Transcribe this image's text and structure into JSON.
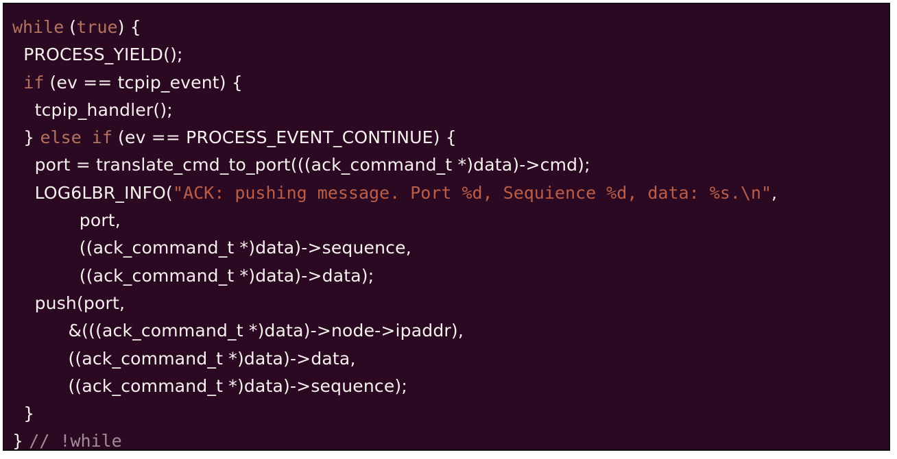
{
  "editor": {
    "background": "#2c0922",
    "colors": {
      "text": "#f6f1ec",
      "keyword": "#b4735f",
      "string": "#bc5e47",
      "comment": "#9e8e94"
    },
    "lines": [
      [
        {
          "t": "kw",
          "v": "while"
        },
        {
          "t": "txt",
          "v": " ("
        },
        {
          "t": "kw",
          "v": "true"
        },
        {
          "t": "txt",
          "v": ") {"
        }
      ],
      [
        {
          "t": "txt",
          "v": "  PROCESS_YIELD();"
        }
      ],
      [
        {
          "t": "txt",
          "v": "  "
        },
        {
          "t": "kw",
          "v": "if"
        },
        {
          "t": "txt",
          "v": " (ev == tcpip_event) {"
        }
      ],
      [
        {
          "t": "txt",
          "v": "    tcpip_handler();"
        }
      ],
      [
        {
          "t": "txt",
          "v": "  } "
        },
        {
          "t": "kw",
          "v": "else if"
        },
        {
          "t": "txt",
          "v": " (ev == PROCESS_EVENT_CONTINUE) {"
        }
      ],
      [
        {
          "t": "txt",
          "v": "    port = translate_cmd_to_port(((ack_command_t *)data)->cmd);"
        }
      ],
      [
        {
          "t": "txt",
          "v": "    LOG6LBR_INFO("
        },
        {
          "t": "str",
          "v": "\"ACK: pushing message. Port %d, Sequience %d, data: %s.\\n\""
        },
        {
          "t": "txt",
          "v": ","
        }
      ],
      [
        {
          "t": "txt",
          "v": "            port,"
        }
      ],
      [
        {
          "t": "txt",
          "v": "            ((ack_command_t *)data)->sequence,"
        }
      ],
      [
        {
          "t": "txt",
          "v": "            ((ack_command_t *)data)->data);"
        }
      ],
      [
        {
          "t": "txt",
          "v": "    push(port,"
        }
      ],
      [
        {
          "t": "txt",
          "v": "          &(((ack_command_t *)data)->node->ipaddr),"
        }
      ],
      [
        {
          "t": "txt",
          "v": "          ((ack_command_t *)data)->data,"
        }
      ],
      [
        {
          "t": "txt",
          "v": "          ((ack_command_t *)data)->sequence);"
        }
      ],
      [
        {
          "t": "txt",
          "v": "  }"
        }
      ],
      [
        {
          "t": "txt",
          "v": "} "
        },
        {
          "t": "cmt",
          "v": "// !while"
        }
      ]
    ]
  }
}
